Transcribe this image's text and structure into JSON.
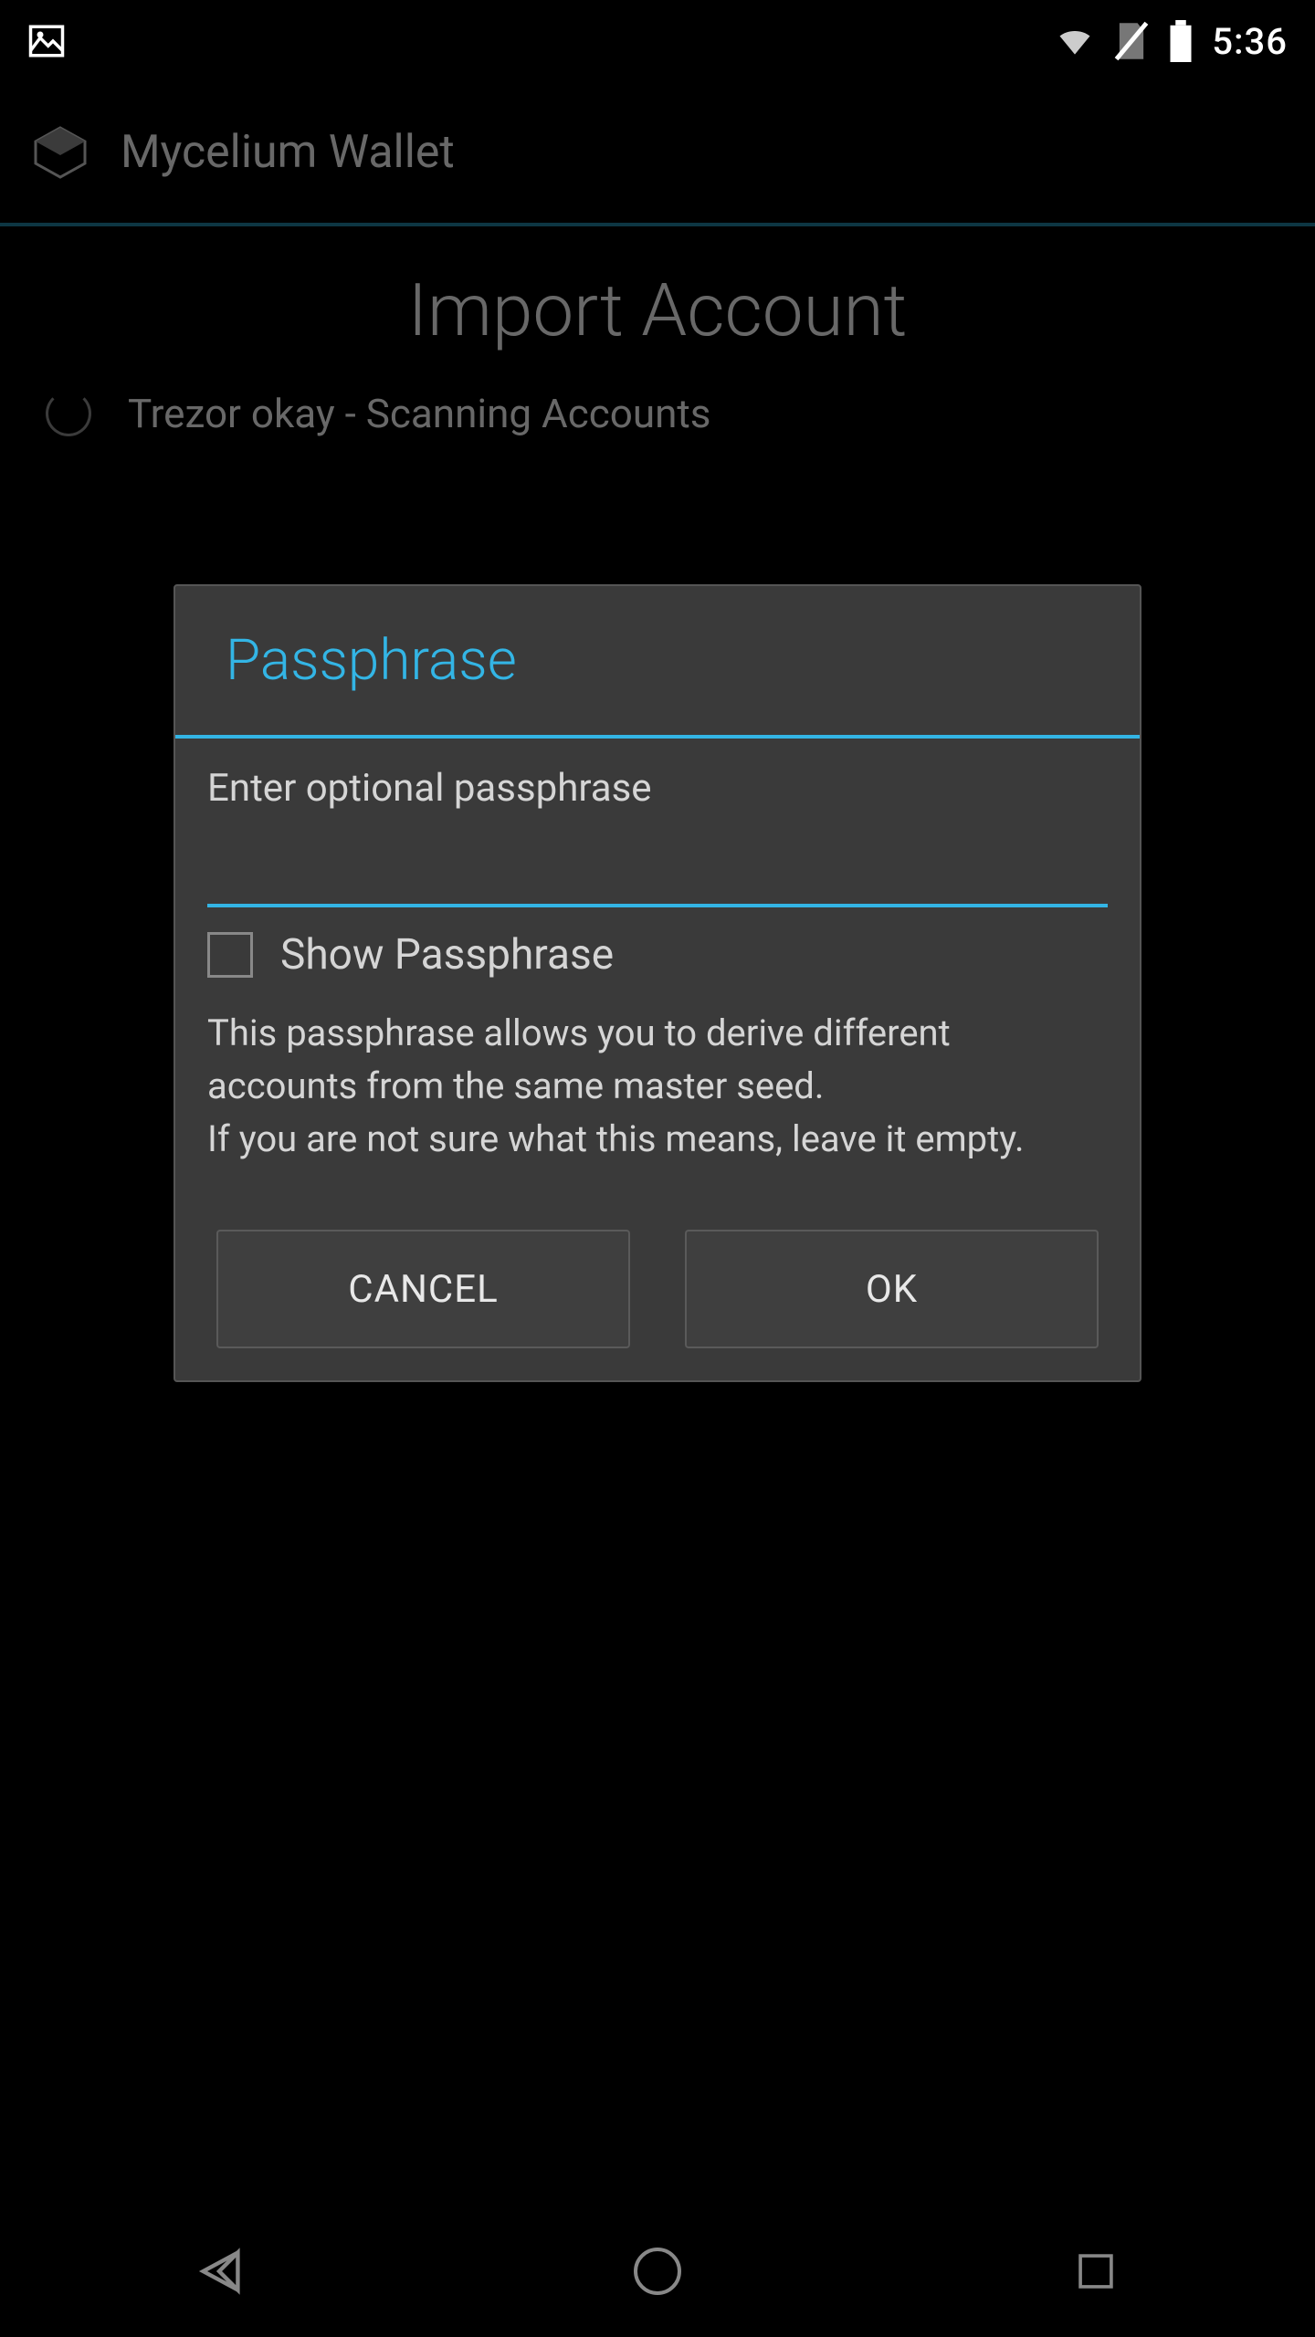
{
  "status": {
    "time": "5:36"
  },
  "app": {
    "title": "Mycelium Wallet"
  },
  "page": {
    "heading": "Import Account",
    "scanning_text": "Trezor okay - Scanning Accounts"
  },
  "dialog": {
    "title": "Passphrase",
    "field_label": "Enter optional passphrase",
    "input_value": "",
    "show_label": "Show Passphrase",
    "description": "This passphrase allows you to derive different accounts from the same master seed.\nIf you are not sure what this means, leave it empty.",
    "cancel_label": "CANCEL",
    "ok_label": "OK"
  },
  "colors": {
    "accent": "#33b5e5",
    "dialog_bg": "#3a3a3a"
  }
}
